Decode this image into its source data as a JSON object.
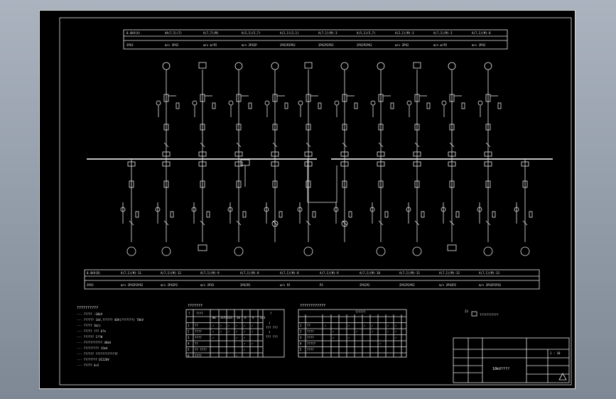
{
  "sheet": {
    "background": "#000000",
    "line_color": "#e6e6e6",
    "frame_color": "#d8d8d8"
  },
  "top_table": {
    "row1": [
      "0.4kV(A)",
      "AA(7,5)(7)",
      "A(7,7)(M)",
      "A(5,1)(5,7)",
      "A(2,1)(2,1)",
      "A(7,1)(M)-3",
      "A(5,1)(5,7)",
      "A(2,1)(M)-3",
      "A(7,1)(M)-3",
      "A(7,1)(M)-8"
    ],
    "row2": [
      "2PX2",
      "m/s 2PX2",
      "m/s m/P2",
      "m/s 2PX2P",
      "2PX2P2PX2",
      "2PX2P2PX2",
      "2PX2P2PX2",
      "m/s 2PX2",
      "m/s m/P2",
      "m/s 2PX2"
    ]
  },
  "bottom_table": {
    "row1": [
      "0.4kV(B)",
      "A(7,1)(M)-11",
      "A(7,1)(M)-12",
      "A(7,1)(M)-9",
      "A(7,1)(M)-8",
      "A(7,1)(M)-8",
      "A(7,1)(M)-9",
      "A(7,1)(M)-10",
      "A(7,1)(M)-11",
      "A(7,1)(M)-12",
      "A(7,1)(M)-13"
    ],
    "row2": [
      "2PX2",
      "m/s 2PX2P2PX2",
      "m/s 2PX2P2",
      "m/s 2PX2",
      "2PX2P2",
      "m/s P2",
      "P2",
      "2PX2P2",
      "2PX2P2PX2",
      "m/s 2PX2P2",
      "m/s 2PX2P2PX2"
    ]
  },
  "notes": {
    "title": "??????????",
    "lines": [
      "--- ????? :10kV",
      "--- ?????? 1kV,?????? 4DV(???????) T0kV",
      "--- ????? 3Ω/s",
      "--- ????? ??? 6?%",
      "--- ?????? 1??W",
      "--- ??????????? 40kA",
      "--- ????????? 15kA",
      "--- ?????? ????????????F",
      "--- ???????? DC220V",
      "--- ????? 6+5"
    ]
  },
  "table1": {
    "title": "???????",
    "header": [
      "?",
      "????",
      "?"
    ],
    "subheader": [
      "No",
      "Isf/s",
      "In",
      "Ik",
      "A",
      "V",
      "S/V"
    ],
    "side_notes": [
      "?",
      "??? ???",
      "?",
      "??? ???"
    ],
    "rows": [
      [
        "1",
        "??",
        "✓",
        "✓",
        "✓",
        "✓",
        "✓",
        "✓"
      ],
      [
        "2",
        "????",
        "✓",
        "✓",
        "✓",
        "✓",
        "✓",
        "✓"
      ],
      [
        "3",
        "????",
        "✓",
        "",
        "",
        "✓",
        "✓",
        ""
      ],
      [
        "4",
        "??",
        "",
        "",
        "",
        "",
        "✓",
        "✓"
      ],
      [
        "5",
        "?? ????",
        "",
        "",
        "",
        "",
        "✓",
        ""
      ],
      [
        "6",
        "????",
        "",
        "",
        "",
        "✓",
        "",
        ""
      ]
    ]
  },
  "table2": {
    "title": "????????????",
    "group_label": "??????",
    "rows": [
      [
        "1",
        "??",
        "✓",
        "",
        "",
        "✓",
        "",
        "✓",
        "✓",
        "",
        "✓",
        "✓"
      ],
      [
        "2",
        "????",
        "",
        "✓",
        "",
        "",
        "✓",
        "",
        "✓",
        "",
        "✓",
        "✓"
      ],
      [
        "3",
        "????",
        "",
        "✓",
        "",
        "✓",
        "",
        "",
        "",
        "",
        "",
        "✓"
      ],
      [
        "4",
        "?????",
        "",
        "",
        "",
        "",
        "",
        "",
        "",
        "✓",
        "",
        ""
      ],
      [
        "5",
        "????",
        "",
        "",
        "",
        "",
        "",
        "",
        "",
        "",
        "",
        ""
      ]
    ]
  },
  "legend": {
    "number": "23",
    "text": "???????????"
  },
  "title_block": {
    "drawing_title": "10kV????",
    "scale": "1 : 10"
  }
}
